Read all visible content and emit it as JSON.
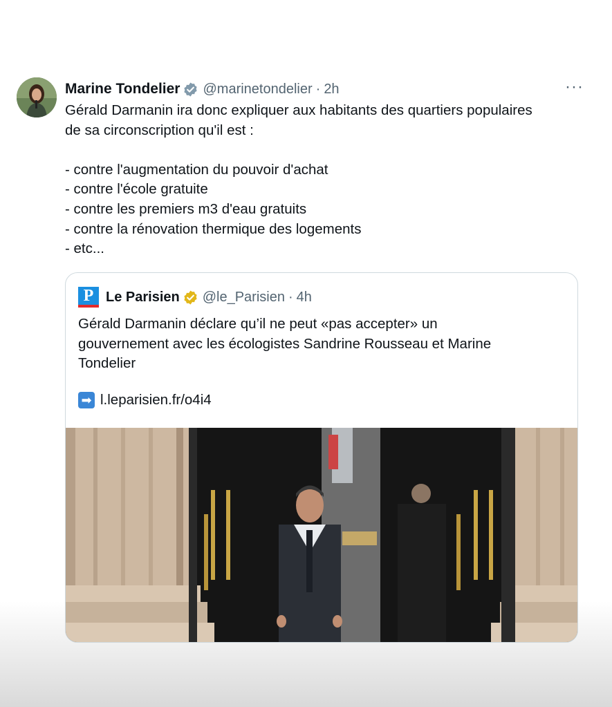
{
  "tweet": {
    "author_name": "Marine Tondelier",
    "author_handle": "@marinetondelier",
    "separator": "·",
    "time": "2h",
    "more_label": "···",
    "text": "Gérald Darmanin ira donc expliquer aux habitants des quartiers populaires\nde sa circonscription qu'il est :\n\n- contre l'augmentation du pouvoir d'achat\n- contre l'école gratuite\n- contre les premiers m3 d'eau gratuits\n- contre la rénovation thermique des logements\n- etc...",
    "verified_color": "#829aab"
  },
  "quote": {
    "logo_letter": "P",
    "author_name": "Le Parisien",
    "author_handle": "@le_Parisien",
    "separator": "·",
    "time": "4h",
    "text": "Gérald Darmanin déclare qu’il ne peut «pas accepter» un\ngouvernement avec les écologistes Sandrine Rousseau et Marine\nTondelier",
    "link_icon": "➡",
    "link_text": "l.leparisien.fr/o4i4",
    "verified_color": "#e2b719"
  }
}
